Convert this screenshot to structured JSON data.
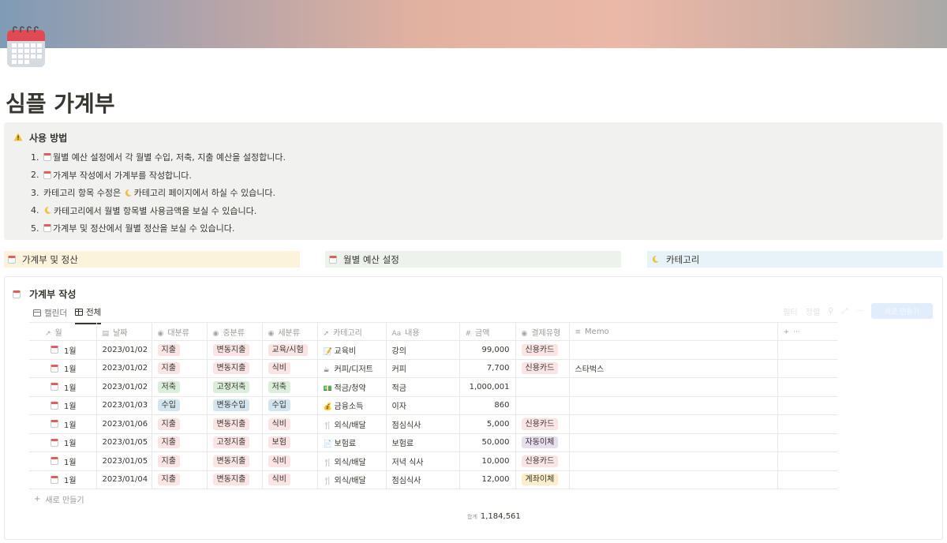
{
  "page": {
    "title": "심플 가계부"
  },
  "callout": {
    "heading": "사용 방법",
    "items": [
      {
        "num": "1.",
        "prefix": "",
        "link": "월별 예산 설정",
        "rest": "에서 각 월별 수입, 저축, 지출 예산을 설정합니다.",
        "link_icon": "calendar"
      },
      {
        "num": "2.",
        "prefix": "",
        "link": "가계부 작성",
        "rest": "에서 가계부를 작성합니다.",
        "link_icon": "calendar"
      },
      {
        "num": "3.",
        "prefix": "카테고리 항목 수정은 ",
        "link": "카테고리",
        "rest": " 페이지에서 하실 수 있습니다.",
        "link_icon": "moon"
      },
      {
        "num": "4.",
        "prefix": "",
        "link": "카테고리",
        "rest": "에서 월별 항목별 사용금액을 보실 수 있습니다.",
        "link_icon": "moon"
      },
      {
        "num": "5.",
        "prefix": "",
        "link": "가계부 및 정산",
        "rest": "에서 월별 정산을 보실 수 있습니다.",
        "link_icon": "calendar"
      }
    ]
  },
  "links": {
    "ledger_settlement": "가계부 및 정산",
    "monthly_budget": "월별 예산 설정",
    "category": "카테고리"
  },
  "database": {
    "title": "가계부 작성",
    "views": {
      "calendar": "캘린더",
      "all": "전체"
    },
    "toolbar": {
      "filter": "필터",
      "sort": "정렬",
      "new_button": "새로 만들기"
    },
    "columns": {
      "month": "월",
      "date": "날짜",
      "major": "대분류",
      "middle": "중분류",
      "minor": "세분류",
      "category": "카테고리",
      "content": "내용",
      "amount": "금액",
      "payment": "결제유형",
      "memo": "Memo"
    },
    "rows": [
      {
        "month": "1월",
        "date": "2023/01/02",
        "major": "지출",
        "middle": "변동지출",
        "minor": "교육/시험",
        "cat_icon": "memo-icon",
        "category": "교육비",
        "content": "강의",
        "amount": "99,000",
        "payment": "신용카드",
        "memo": ""
      },
      {
        "month": "1월",
        "date": "2023/01/02",
        "major": "지출",
        "middle": "변동지출",
        "minor": "식비",
        "cat_icon": "coffee-icon",
        "category": "커피/디저트",
        "content": "커피",
        "amount": "7,700",
        "payment": "신용카드",
        "memo": "스타벅스"
      },
      {
        "month": "1월",
        "date": "2023/01/02",
        "major": "저축",
        "middle": "고정저축",
        "minor": "저축",
        "cat_icon": "money-icon",
        "category": "적금/청약",
        "content": "적금",
        "amount": "1,000,001",
        "payment": "",
        "memo": ""
      },
      {
        "month": "1월",
        "date": "2023/01/03",
        "major": "수입",
        "middle": "변동수입",
        "minor": "수입",
        "cat_icon": "moneybag-icon",
        "category": "금융소득",
        "content": "이자",
        "amount": "860",
        "payment": "",
        "memo": ""
      },
      {
        "month": "1월",
        "date": "2023/01/06",
        "major": "지출",
        "middle": "변동지출",
        "minor": "식비",
        "cat_icon": "fork-knife-icon",
        "category": "외식/배달",
        "content": "점심식사",
        "amount": "5,000",
        "payment": "신용카드",
        "memo": ""
      },
      {
        "month": "1월",
        "date": "2023/01/05",
        "major": "지출",
        "middle": "고정지출",
        "minor": "보험",
        "cat_icon": "document-icon",
        "category": "보험료",
        "content": "보험료",
        "amount": "50,000",
        "payment": "자동이체",
        "memo": ""
      },
      {
        "month": "1월",
        "date": "2023/01/05",
        "major": "지출",
        "middle": "변동지출",
        "minor": "식비",
        "cat_icon": "fork-knife-icon",
        "category": "외식/배달",
        "content": "저녁 식사",
        "amount": "10,000",
        "payment": "신용카드",
        "memo": ""
      },
      {
        "month": "1월",
        "date": "2023/01/04",
        "major": "지출",
        "middle": "변동지출",
        "minor": "식비",
        "cat_icon": "fork-knife-icon",
        "category": "외식/배달",
        "content": "점심식사",
        "amount": "12,000",
        "payment": "계좌이체",
        "memo": ""
      }
    ],
    "new_row": "새로 만들기",
    "sum_label": "합계",
    "sum_value": "1,184,561"
  },
  "colors": {
    "red_tag": "#fbe4e4",
    "green_tag": "#dbeddb",
    "blue_tag": "#d3e5ef",
    "purple_tag": "#e8deee",
    "yellow_tag": "#fbeecc",
    "callout_bg": "#f1f1ef"
  }
}
